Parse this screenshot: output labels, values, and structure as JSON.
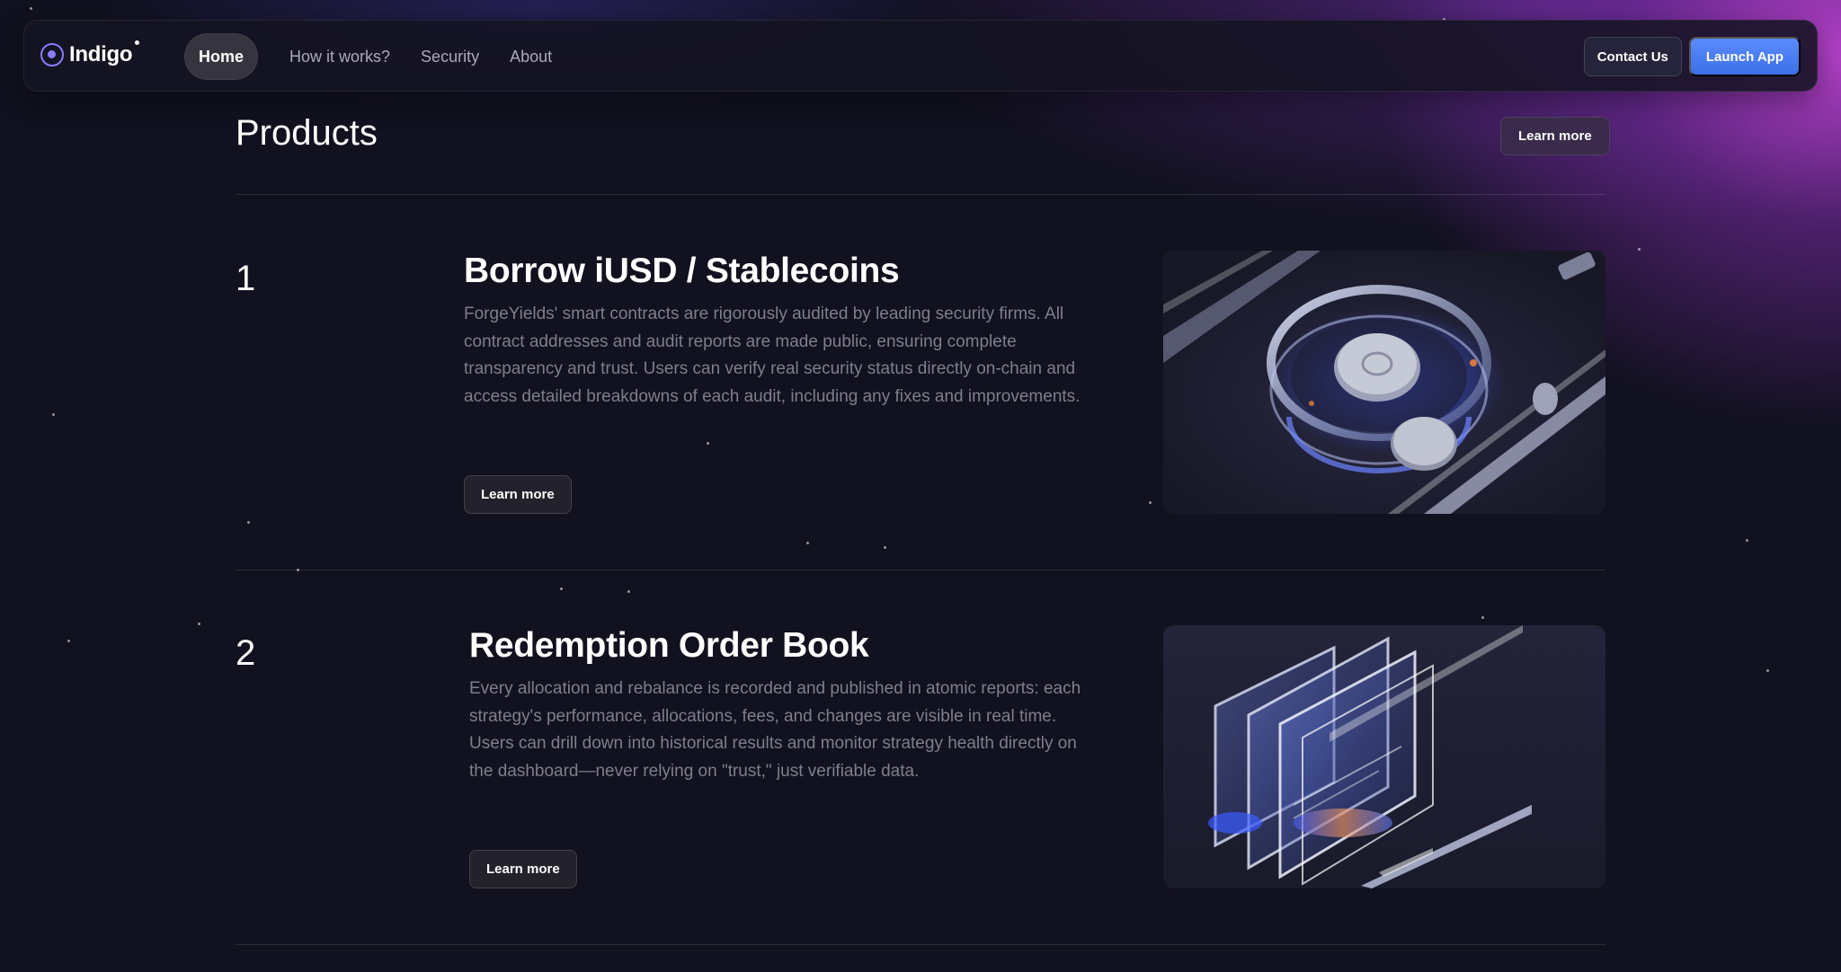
{
  "nav": {
    "logo_text": "Indigo",
    "links": [
      {
        "label": "Home",
        "active": true
      },
      {
        "label": "How it works?"
      },
      {
        "label": "Security"
      },
      {
        "label": "About"
      }
    ],
    "contact_label": "Contact Us",
    "launch_label": "Launch App"
  },
  "products": {
    "title": "Products",
    "learn_more_label": "Learn more",
    "items": [
      {
        "number": "1",
        "title": "Borrow iUSD / Stablecoins",
        "description": "ForgeYields' smart contracts are rigorously audited by leading security firms. All contract addresses and audit reports are made public, ensuring complete transparency and trust. Users can verify real security status directly on-chain and access detailed breakdowns of each audit, including any fixes and improvements.",
        "button_label": "Learn more",
        "image": "glass-coin-vault-render"
      },
      {
        "number": "2",
        "title": "Redemption Order Book",
        "description": "Every allocation and rebalance is recorded and published in atomic reports: each strategy's performance, allocations, fees, and changes are visible in real time. Users can drill down into historical results and monitor strategy health directly on the dashboard—never relying on \"trust,\" just verifiable data.",
        "button_label": "Learn more",
        "image": "glass-panels-render"
      }
    ]
  },
  "colors": {
    "background": "#11111f",
    "accent": "#8b7bff",
    "launch_button": "#4a7dff",
    "glow": "#c846dc"
  }
}
